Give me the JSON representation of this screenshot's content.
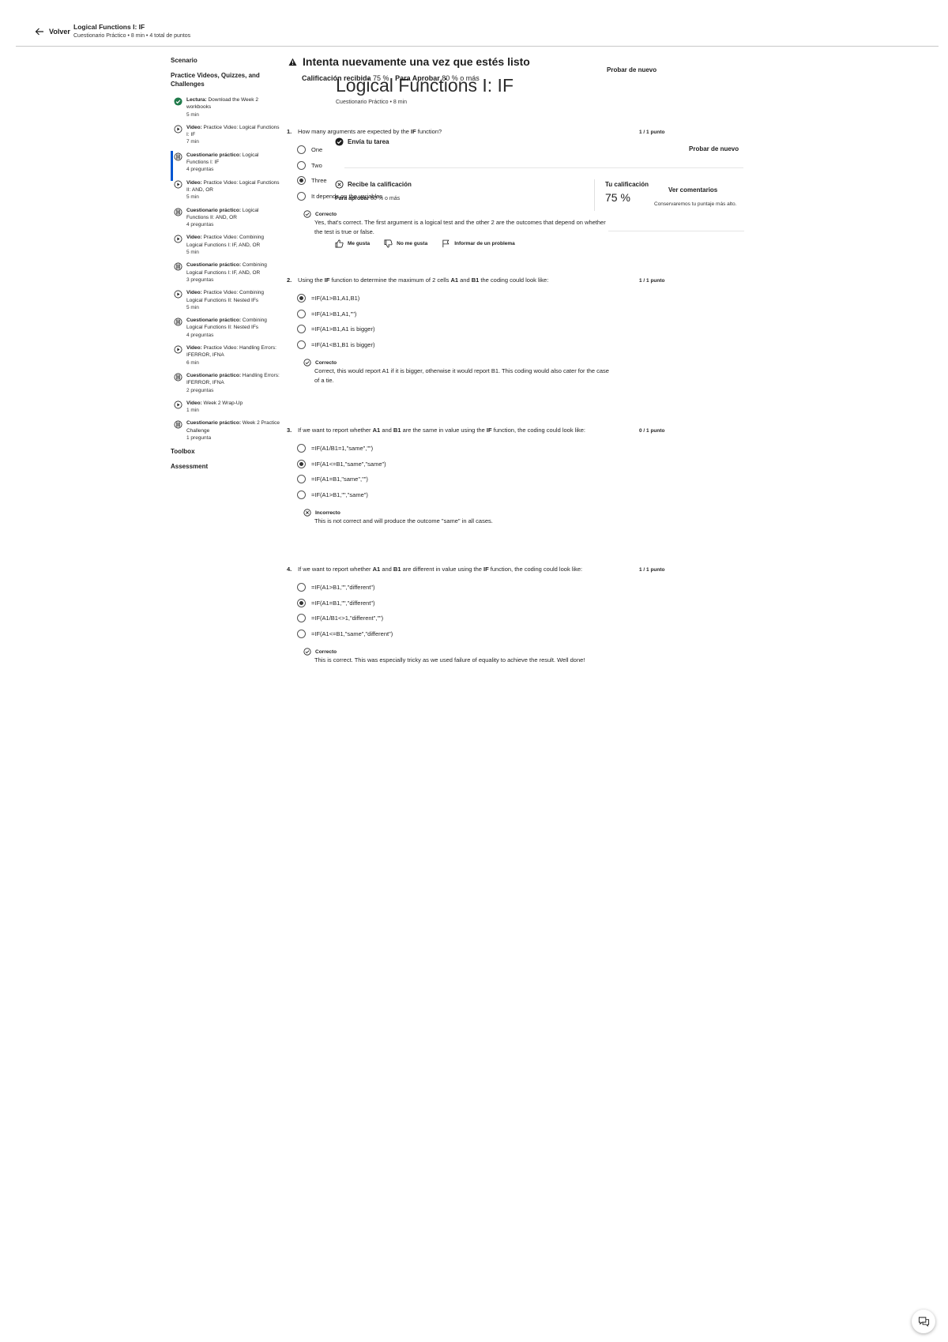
{
  "header": {
    "back_label": "Volver",
    "title": "Logical Functions I: IF",
    "subtitle": "Cuestionario Práctico • 8 min • 4 total de puntos"
  },
  "sidebar": {
    "scenario": "Scenario",
    "section": "Practice Videos, Quizzes, and Challenges",
    "items": [
      {
        "kind": "Lectura:",
        "title": " Download the Week 2 workbooks",
        "meta": "5 min",
        "icon": "check-circle-icon"
      },
      {
        "kind": "Video:",
        "title": " Practice Video: Logical Functions I: IF",
        "meta": "7 min",
        "icon": "play-icon"
      },
      {
        "kind": "Cuestionario práctico:",
        "title": " Logical Functions I: IF",
        "meta": "4 preguntas",
        "icon": "quiz-icon"
      },
      {
        "kind": "Video:",
        "title": " Practice Video: Logical Functions II: AND, OR",
        "meta": "5 min",
        "icon": "play-icon"
      },
      {
        "kind": "Cuestionario práctico:",
        "title": " Logical Functions II: AND, OR",
        "meta": "4 preguntas",
        "icon": "quiz-icon"
      },
      {
        "kind": "Video:",
        "title": " Practice Video: Combining Logical Functions I: IF, AND, OR",
        "meta": "5 min",
        "icon": "play-icon"
      },
      {
        "kind": "Cuestionario práctico:",
        "title": " Combining Logical Functions I: IF, AND, OR",
        "meta": "3 preguntas",
        "icon": "quiz-icon"
      },
      {
        "kind": "Video:",
        "title": " Practice Video: Combining Logical Functions II: Nested IFs",
        "meta": "5 min",
        "icon": "play-icon"
      },
      {
        "kind": "Cuestionario práctico:",
        "title": " Combining Logical Functions II: Nested IFs",
        "meta": "4 preguntas",
        "icon": "quiz-icon"
      },
      {
        "kind": "Video:",
        "title": " Practice Video: Handling Errors: IFERROR, IFNA",
        "meta": "6 min",
        "icon": "play-icon"
      },
      {
        "kind": "Cuestionario práctico:",
        "title": " Handling Errors: IFERROR, IFNA",
        "meta": "2 preguntas",
        "icon": "quiz-icon"
      },
      {
        "kind": "Video:",
        "title": " Week 2 Wrap-Up",
        "meta": "1 min",
        "icon": "play-icon"
      },
      {
        "kind": "Cuestionario práctico:",
        "title": " Week 2 Practice Challenge",
        "meta": "1 pregunta",
        "icon": "quiz-icon"
      }
    ],
    "toolbox": "Toolbox",
    "assessment": "Assessment"
  },
  "banner": {
    "title": "Intenta nuevamente una vez que estés listo",
    "grade_label": "Calificación recibida",
    "grade_value": "75 %",
    "pass_label": "Para Aprobar",
    "pass_value": "80 % o más",
    "retry": "Probar de nuevo"
  },
  "quiz": {
    "title": "Logical Functions I: IF",
    "subtitle": "Cuestionario Práctico • 8 min",
    "retry": "Probar de nuevo",
    "submit_step": "Envía tu tarea",
    "grade_step": "Recibe la calificación",
    "pass_label": "Para aprobar",
    "pass_value": "80 % o más",
    "your_grade_label": "Tu calificación",
    "your_grade_value": "75 %",
    "feedback": "Ver comentarios",
    "keep_score": "Conservaremos tu puntaje más alto.",
    "like": "Me gusta",
    "dislike": "No me gusta",
    "report": "Informar de un problema"
  },
  "questions": [
    {
      "num": "1.",
      "text_a": "How many arguments are expected by the ",
      "text_b": "IF",
      "text_c": " function?",
      "score": "1 / 1 punto",
      "options": [
        "One",
        "Two",
        "Three",
        "It depends on the variables"
      ],
      "selected": 2,
      "feedback_head": "Correcto",
      "feedback": "Yes, that's correct. The first argument is a logical test and the other 2 are the outcomes that depend on whether the test is true or false."
    },
    {
      "num": "2.",
      "text_a": "Using the ",
      "text_b": "IF",
      "text_c": " function to determine the maximum of 2 cells ",
      "text_d": "A1",
      "text_e": " and ",
      "text_f": "B1",
      "text_g": " the coding could look like:",
      "score": "1 / 1 punto",
      "options": [
        "=IF(A1>B1,A1,B1)",
        "=IF(A1>B1,A1,\"\")",
        "=IF(A1>B1,A1 is bigger)",
        "=IF(A1<B1,B1 is bigger)"
      ],
      "selected": 0,
      "feedback_head": "Correcto",
      "feedback": "Correct, this would report A1 if it is bigger, otherwise it would report B1. This coding would also cater for the case of a tie."
    },
    {
      "num": "3.",
      "text_a": "If we want to report whether ",
      "text_b": "A1",
      "text_c": " and ",
      "text_d": "B1",
      "text_e": " are the same in value using the ",
      "text_f": "IF",
      "text_g": " function, the coding could look like:",
      "score": "0 / 1 punto",
      "options": [
        "=IF(A1/B1=1,\"same\",\"\")",
        "=IF(A1<=B1,\"same\",\"same\")",
        "=IF(A1=B1,\"same\",\"\")",
        "=IF(A1>B1,\"\",\"same\")"
      ],
      "selected": 1,
      "feedback_head": "Incorrecto",
      "feedback": "This is not correct and will produce the outcome \"same\" in all cases."
    },
    {
      "num": "4.",
      "text_a": "If we want to report whether ",
      "text_b": "A1",
      "text_c": " and ",
      "text_d": "B1",
      "text_e": " are different in value using the ",
      "text_f": "IF",
      "text_g": " function, the coding could look like:",
      "score": "1 / 1 punto",
      "options": [
        "=IF(A1>B1,\"\",\"different\")",
        "=IF(A1=B1,\"\",\"different\")",
        "=IF(A1/B1<>1,\"different\",\"\")",
        "=IF(A1<=B1,\"same\",\"different\")"
      ],
      "selected": 1,
      "feedback_head": "Correcto",
      "feedback": "This is correct. This was especially tricky as we used failure of equality to achieve the result. Well done!"
    }
  ]
}
